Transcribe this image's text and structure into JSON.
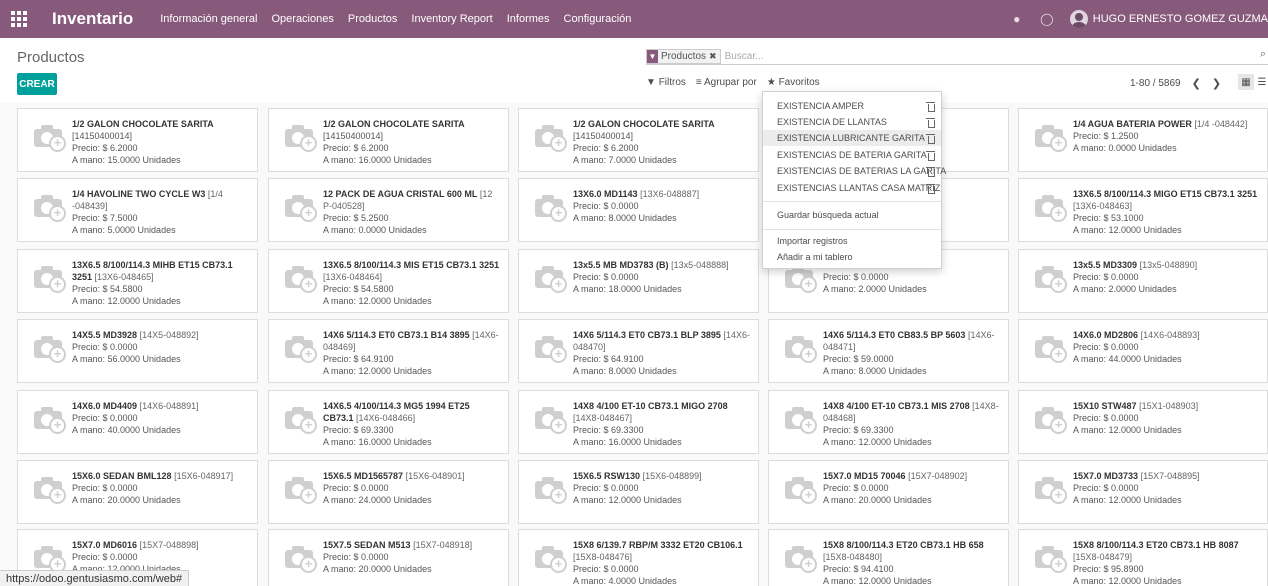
{
  "navbar": {
    "app_title": "Inventario",
    "menu": [
      "Información general",
      "Operaciones",
      "Productos",
      "Inventory Report",
      "Informes",
      "Configuración"
    ],
    "user_name": "HUGO ERNESTO GOMEZ GUZMA"
  },
  "control": {
    "breadcrumb": "Productos",
    "search_facet": "Productos",
    "search_placeholder": "Buscar...",
    "create_label": "CREAR",
    "filters_label": "Filtros",
    "groupby_label": "Agrupar por",
    "favorites_label": "Favoritos",
    "pager": "1-80 / 5869"
  },
  "favorites_dropdown": {
    "saved": [
      "EXISTENCIA AMPER",
      "EXISTENCIA DE LLANTAS",
      "EXISTENCIA LUBRICANTE GARITA",
      "EXISTENCIAS DE BATERIA GARITA",
      "EXISTENCIAS DE BATERIAS LA GARITA",
      "EXISTENCIAS LLANTAS CASA MATRIZ"
    ],
    "save_search": "Guardar búsqueda actual",
    "import": "Importar registros",
    "add_dashboard": "Añadir a mi tablero"
  },
  "products": [
    {
      "name": "1/2 GALON CHOCOLATE SARITA",
      "code": "",
      "lines": [
        "[14150400014]",
        "Precio: $ 6.2000",
        "A mano: 15.0000 Unidades"
      ]
    },
    {
      "name": "1/2 GALON CHOCOLATE SARITA",
      "code": "",
      "lines": [
        "[14150400014]",
        "Precio: $ 6.2000",
        "A mano: 16.0000 Unidades"
      ]
    },
    {
      "name": "1/2 GALON CHOCOLATE SARITA",
      "code": "",
      "lines": [
        "[14150400014]",
        "Precio: $ 6.2000",
        "A mano: 7.0000 Unidades"
      ]
    },
    {
      "name": "",
      "code": "",
      "lines": []
    },
    {
      "name": "1/4 AGUA BATERIA POWER",
      "code": "[1/4 -048442]",
      "lines": [
        "Precio: $ 1.2500",
        "A mano: 0.0000 Unidades"
      ]
    },
    {
      "name": "1/4 HAVOLINE TWO CYCLE W3",
      "code": "[1/4 -048439]",
      "lines": [
        "Precio: $ 7.5000",
        "A mano: 5.0000 Unidades"
      ]
    },
    {
      "name": "12 PACK DE AGUA CRISTAL 600 ML",
      "code": "[12 P-040528]",
      "lines": [
        "Precio: $ 5.2500",
        "A mano: 0.0000 Unidades"
      ]
    },
    {
      "name": "13X6.0 MD1143",
      "code": "[13X6-048887]",
      "lines": [
        "Precio: $ 0.0000",
        "A mano: 8.0000 Unidades"
      ]
    },
    {
      "name": "",
      "code": "",
      "lines": []
    },
    {
      "name": "13X6.5 8/100/114.3 MIGO ET15 CB73.1 3251",
      "code": "[13X6-048463]",
      "lines": [
        "Precio: $ 53.1000",
        "A mano: 12.0000 Unidades"
      ]
    },
    {
      "name": "13X6.5 8/100/114.3 MIHB ET15 CB73.1 3251",
      "code": "[13X6-048465]",
      "lines": [
        "Precio: $ 54.5800",
        "A mano: 12.0000 Unidades"
      ]
    },
    {
      "name": "13X6.5 8/100/114.3 MIS ET15 CB73.1 3251",
      "code": "[13X6-048464]",
      "lines": [
        "Precio: $ 54.5800",
        "A mano: 12.0000 Unidades"
      ]
    },
    {
      "name": "13x5.5 MB MD3783 (B)",
      "code": "[13x5-048888]",
      "lines": [
        "Precio: $ 0.0000",
        "A mano: 18.0000 Unidades"
      ]
    },
    {
      "name": "",
      "code": "",
      "lines": [
        "Precio: $ 0.0000",
        "A mano: 2.0000 Unidades"
      ]
    },
    {
      "name": "13x5.5 MD3309",
      "code": "[13x5-048890]",
      "lines": [
        "Precio: $ 0.0000",
        "A mano: 2.0000 Unidades"
      ]
    },
    {
      "name": "14X5.5 MD3928",
      "code": "[14X5-048892]",
      "lines": [
        "Precio: $ 0.0000",
        "A mano: 56.0000 Unidades"
      ]
    },
    {
      "name": "14X6 5/114.3 ET0 CB73.1 B14 3895",
      "code": "[14X6-048469]",
      "lines": [
        "Precio: $ 64.9100",
        "A mano: 12.0000 Unidades"
      ]
    },
    {
      "name": "14X6 5/114.3 ET0 CB73.1 BLP 3895",
      "code": "[14X6-048470]",
      "lines": [
        "Precio: $ 64.9100",
        "A mano: 8.0000 Unidades"
      ]
    },
    {
      "name": "14X6 5/114.3 ET0 CB83.5 BP 5603",
      "code": "[14X6-048471]",
      "lines": [
        "Precio: $ 59.0000",
        "A mano: 8.0000 Unidades"
      ]
    },
    {
      "name": "14X6.0 MD2806",
      "code": "[14X6-048893]",
      "lines": [
        "Precio: $ 0.0000",
        "A mano: 44.0000 Unidades"
      ]
    },
    {
      "name": "14X6.0 MD4409",
      "code": "[14X6-048891]",
      "lines": [
        "Precio: $ 0.0000",
        "A mano: 40.0000 Unidades"
      ]
    },
    {
      "name": "14X6.5 4/100/114.3 MG5 1994 ET25 CB73.1",
      "code": "[14X6-048466]",
      "lines": [
        "Precio: $ 69.3300",
        "A mano: 16.0000 Unidades"
      ]
    },
    {
      "name": "14X8 4/100 ET-10 CB73.1 MIGO 2708",
      "code": "[14X8-048467]",
      "lines": [
        "Precio: $ 69.3300",
        "A mano: 16.0000 Unidades"
      ]
    },
    {
      "name": "14X8 4/100 ET-10 CB73.1 MIS 2708",
      "code": "[14X8-048468]",
      "lines": [
        "Precio: $ 69.3300",
        "A mano: 12.0000 Unidades"
      ]
    },
    {
      "name": "15X10 STW487",
      "code": "[15X1-048903]",
      "lines": [
        "Precio: $ 0.0000",
        "A mano: 12.0000 Unidades"
      ]
    },
    {
      "name": "15X6.0 SEDAN BML128",
      "code": "[15X6-048917]",
      "lines": [
        "Precio: $ 0.0000",
        "A mano: 20.0000 Unidades"
      ]
    },
    {
      "name": "15X6.5 MD1565787",
      "code": "[15X6-048901]",
      "lines": [
        "Precio: $ 0.0000",
        "A mano: 24.0000 Unidades"
      ]
    },
    {
      "name": "15X6.5 RSW130",
      "code": "[15X6-048899]",
      "lines": [
        "Precio: $ 0.0000",
        "A mano: 12.0000 Unidades"
      ]
    },
    {
      "name": "15X7.0 MD15 70046",
      "code": "[15X7-048902]",
      "lines": [
        "Precio: $ 0.0000",
        "A mano: 20.0000 Unidades"
      ]
    },
    {
      "name": "15X7.0 MD3733",
      "code": "[15X7-048895]",
      "lines": [
        "Precio: $ 0.0000",
        "A mano: 12.0000 Unidades"
      ]
    },
    {
      "name": "15X7.0 MD6016",
      "code": "[15X7-048898]",
      "lines": [
        "Precio: $ 0.0000",
        "A mano: 12.0000 Unidades"
      ]
    },
    {
      "name": "15X7.5 SEDAN M513",
      "code": "[15X7-048918]",
      "lines": [
        "Precio: $ 0.0000",
        "A mano: 20.0000 Unidades"
      ]
    },
    {
      "name": "15X8 6/139.7 RBP/M 3332 ET20 CB106.1",
      "code": "[15X8-048476]",
      "lines": [
        "Precio: $ 0.0000",
        "A mano: 4.0000 Unidades"
      ]
    },
    {
      "name": "15X8 8/100/114.3 ET20 CB73.1 HB 658",
      "code": "[15X8-048480]",
      "lines": [
        "Precio: $ 94.4100",
        "A mano: 12.0000 Unidades"
      ]
    },
    {
      "name": "15X8 8/100/114.3 ET20 CB73.1 HB 8087",
      "code": "[15X8-048479]",
      "lines": [
        "Precio: $ 95.8900",
        "A mano: 12.0000 Unidades"
      ]
    }
  ],
  "status_url": "https://odoo.gentusiasmo.com/web#"
}
